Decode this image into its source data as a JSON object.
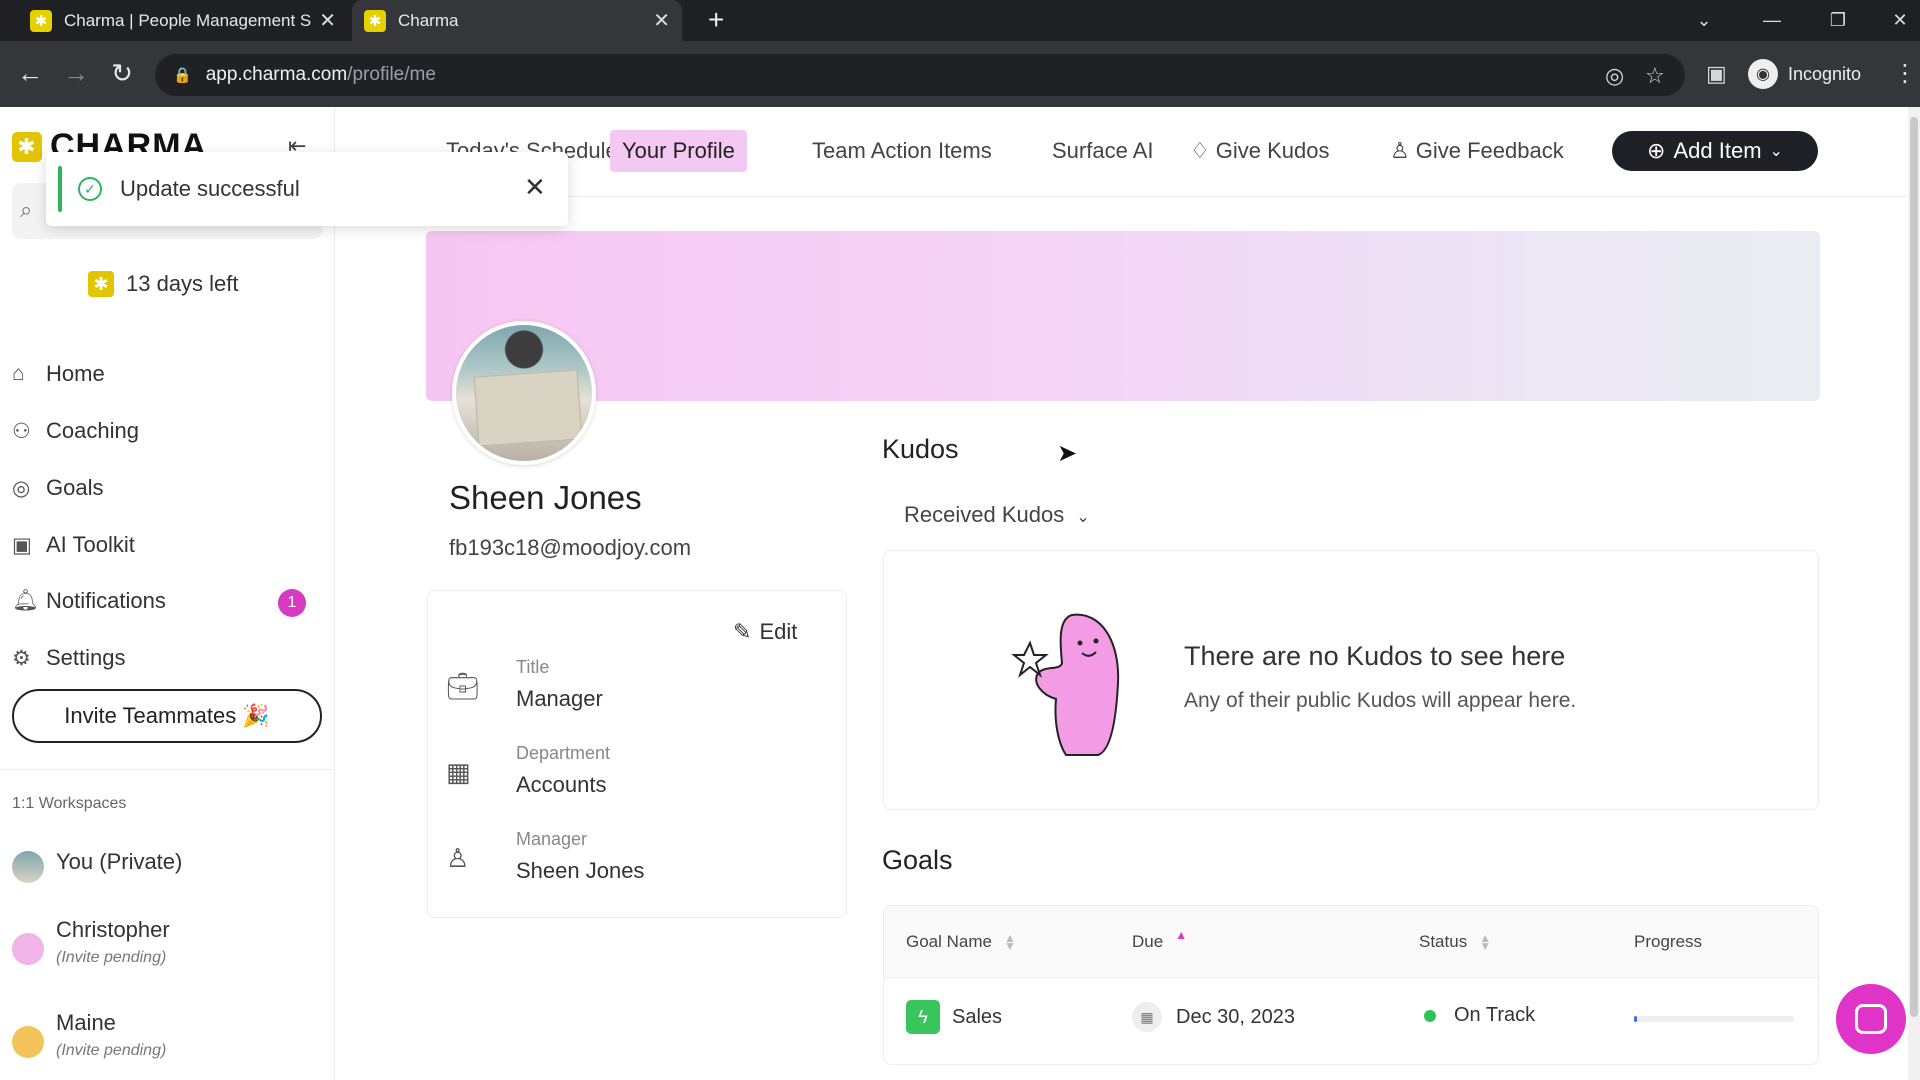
{
  "browser": {
    "tabs": [
      {
        "title": "Charma | People Management S",
        "close": "✕",
        "active": false
      },
      {
        "title": "Charma",
        "close": "✕",
        "active": true
      }
    ],
    "new_tab": "+",
    "url_host": "app.charma.com",
    "url_path": "/profile/me",
    "incognito_label": "Incognito"
  },
  "toast": {
    "message": "Update successful",
    "close": "✕"
  },
  "sidebar": {
    "logo": "CHARMA",
    "trial": "13 days left",
    "nav": [
      {
        "label": "Home",
        "icon": "home-icon"
      },
      {
        "label": "Coaching",
        "icon": "coaching-icon"
      },
      {
        "label": "Goals",
        "icon": "goals-icon"
      },
      {
        "label": "AI Toolkit",
        "icon": "robot-icon"
      },
      {
        "label": "Notifications",
        "icon": "bell-icon",
        "badge": "1"
      },
      {
        "label": "Settings",
        "icon": "gear-icon"
      }
    ],
    "invite_label": "Invite Teammates 🎉",
    "workspaces_label": "1:1 Workspaces",
    "workspaces": [
      {
        "name": "You (Private)",
        "sub": ""
      },
      {
        "name": "Christopher",
        "sub": "(Invite pending)"
      },
      {
        "name": "Maine",
        "sub": "(Invite pending)"
      }
    ]
  },
  "topnav": {
    "items": [
      "Today's Schedule",
      "Your Profile",
      "Team Action Items",
      "Surface AI",
      "Give Kudos",
      "Give Feedback"
    ],
    "active": "Your Profile",
    "add_item": "Add Item"
  },
  "profile": {
    "name": "Sheen Jones",
    "email": "fb193c18@moodjoy.com",
    "edit_label": "Edit",
    "fields": [
      {
        "label": "Title",
        "value": "Manager",
        "icon": "briefcase-icon"
      },
      {
        "label": "Department",
        "value": "Accounts",
        "icon": "building-icon"
      },
      {
        "label": "Manager",
        "value": "Sheen Jones",
        "icon": "person-icon"
      }
    ]
  },
  "kudos": {
    "title": "Kudos",
    "filter": "Received Kudos",
    "empty_title": "There are no Kudos to see here",
    "empty_sub": "Any of their public Kudos will appear here."
  },
  "goals": {
    "title": "Goals",
    "columns": [
      "Goal Name",
      "Due",
      "Status",
      "Progress"
    ],
    "rows": [
      {
        "name": "Sales",
        "due": "Dec 30, 2023",
        "status": "On Track",
        "progress": 0.02
      }
    ]
  },
  "colors": {
    "accent": "#e034c8",
    "active_tab_bg": "#f3c8f3",
    "status_on_track": "#2fc35a",
    "goal_icon": "#3ac45c"
  }
}
